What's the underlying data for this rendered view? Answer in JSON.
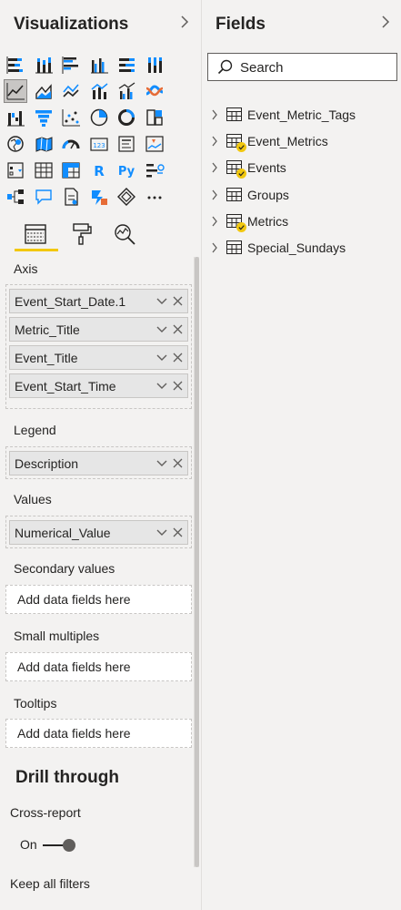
{
  "visualizations": {
    "title": "Visualizations",
    "icons": [
      "stacked-bar-chart",
      "stacked-column-chart",
      "clustered-bar-chart",
      "clustered-column-chart",
      "100-stacked-bar-chart",
      "100-stacked-column-chart",
      "line-chart",
      "area-chart",
      "stacked-area-chart",
      "line-and-stacked-column-chart",
      "line-and-clustered-column-chart",
      "ribbon-chart",
      "waterfall-chart",
      "funnel-chart",
      "scatter-chart",
      "pie-chart",
      "donut-chart",
      "treemap",
      "map",
      "filled-map",
      "gauge",
      "card",
      "multi-row-card",
      "kpi",
      "slicer",
      "table",
      "matrix",
      "r-script-visual",
      "python-visual",
      "key-influencers",
      "decomposition-tree",
      "qa-visual",
      "paginated-report",
      "power-automate",
      "diamond-visual",
      "more-visuals"
    ]
  },
  "tabs": [
    "fields-tab",
    "format-tab",
    "analytics-tab"
  ],
  "wells": {
    "axis": {
      "label": "Axis",
      "items": [
        "Event_Start_Date.1",
        "Metric_Title",
        "Event_Title",
        "Event_Start_Time"
      ]
    },
    "legend": {
      "label": "Legend",
      "items": [
        "Description"
      ]
    },
    "values": {
      "label": "Values",
      "items": [
        "Numerical_Value"
      ]
    },
    "secondary_values": {
      "label": "Secondary values",
      "placeholder": "Add data fields here"
    },
    "small_multiples": {
      "label": "Small multiples",
      "placeholder": "Add data fields here"
    },
    "tooltips": {
      "label": "Tooltips",
      "placeholder": "Add data fields here"
    }
  },
  "drill": {
    "title": "Drill through",
    "cross_report": "Cross-report",
    "toggle_state": "On",
    "keep_filters": "Keep all filters"
  },
  "fields": {
    "title": "Fields",
    "search_placeholder": "Search",
    "tables": [
      {
        "name": "Event_Metric_Tags",
        "checked": false
      },
      {
        "name": "Event_Metrics",
        "checked": true
      },
      {
        "name": "Events",
        "checked": true
      },
      {
        "name": "Groups",
        "checked": false
      },
      {
        "name": "Metrics",
        "checked": true
      },
      {
        "name": "Special_Sundays",
        "checked": false
      }
    ]
  },
  "colors": {
    "accent_yellow": "#f2c80f",
    "icon_blue": "#118dff",
    "icon_dark": "#252423"
  }
}
